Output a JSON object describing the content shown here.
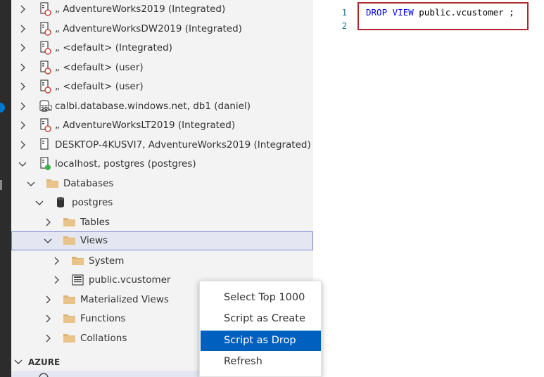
{
  "tree": {
    "items": [
      {
        "label": "„ AdventureWorks2019 (Integrated)"
      },
      {
        "label": "„ AdventureWorksDW2019 (Integrated)"
      },
      {
        "label": "„ <default> (Integrated)"
      },
      {
        "label": "„ <default> (user)"
      },
      {
        "label": "„ <default> (user)"
      },
      {
        "label": "calbi.database.windows.net, db1 (daniel)"
      },
      {
        "label": "„ AdventureWorksLT2019 (Integrated)"
      },
      {
        "label": "DESKTOP-4KUSVI7, AdventureWorks2019 (Integrated)"
      },
      {
        "label": "localhost, postgres (postgres)"
      },
      {
        "label": "Databases"
      },
      {
        "label": "postgres"
      },
      {
        "label": "Tables"
      },
      {
        "label": "Views"
      },
      {
        "label": "System"
      },
      {
        "label": "public.vcustomer"
      },
      {
        "label": "Materialized Views"
      },
      {
        "label": "Functions"
      },
      {
        "label": "Collations"
      }
    ],
    "azure_label": "AZURE"
  },
  "editor": {
    "line_numbers": [
      "1",
      "2"
    ],
    "code": {
      "kw1": "DROP",
      "kw2": "VIEW",
      "rest": " public.vcustomer ;"
    }
  },
  "context_menu": {
    "items": [
      "Select Top 1000",
      "Script as Create",
      "Script as Drop",
      "Refresh"
    ],
    "active_index": 2
  },
  "colors": {
    "accent": "#0060c0",
    "highlight_box": "#b2252a",
    "keyword": "#0000ff",
    "selected_row": "#e4e6f1"
  }
}
